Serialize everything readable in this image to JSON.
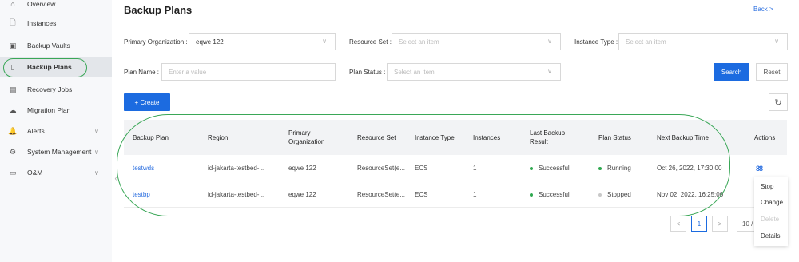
{
  "sidebar": {
    "items": [
      {
        "label": "Overview",
        "icon": "home-icon",
        "glyph": "⌂"
      },
      {
        "label": "Instances",
        "icon": "file-icon",
        "glyph": "🗋"
      },
      {
        "label": "Backup Vaults",
        "icon": "vault-icon",
        "glyph": "▣"
      },
      {
        "label": "Backup Plans",
        "icon": "plan-icon",
        "glyph": "▯"
      },
      {
        "label": "Recovery Jobs",
        "icon": "list-icon",
        "glyph": "▤"
      },
      {
        "label": "Migration Plan",
        "icon": "cloud-icon",
        "glyph": "☁"
      },
      {
        "label": "Alerts",
        "icon": "bell-icon",
        "glyph": "🔔"
      },
      {
        "label": "System Management",
        "icon": "gear-icon",
        "glyph": "⚙"
      },
      {
        "label": "O&M",
        "icon": "monitor-icon",
        "glyph": "▭"
      }
    ],
    "chevron": "∨",
    "collapse_glyph": "‹"
  },
  "header": {
    "title": "Backup Plans",
    "back_label": "Back  >"
  },
  "filters": {
    "primary_org_label": "Primary Organization :",
    "primary_org_value": "eqwe 122",
    "resource_set_label": "Resource Set :",
    "resource_set_placeholder": "Select an item",
    "instance_type_label": "Instance Type :",
    "instance_type_placeholder": "Select an item",
    "plan_name_label": "Plan Name :",
    "plan_name_placeholder": "Enter a value",
    "plan_status_label": "Plan Status :",
    "plan_status_placeholder": "Select an item",
    "dropdown_glyph": "∨"
  },
  "buttons": {
    "search": "Search",
    "reset": "Reset",
    "create": "+  Create",
    "refresh_glyph": "↻"
  },
  "table": {
    "columns": [
      "Backup Plan",
      "Region",
      "Primary Organization",
      "Resource Set",
      "Instance Type",
      "Instances",
      "Last Backup Result",
      "Plan Status",
      "Next Backup Time",
      "Actions"
    ],
    "rows": [
      {
        "plan": "testwds",
        "region": "id-jakarta-testbed-...",
        "org": "eqwe 122",
        "resource_set": "ResourceSet(e...",
        "instance_type": "ECS",
        "instances": "1",
        "last_result": "Successful",
        "status": "Running",
        "next_time": "Oct 26, 2022, 17:30:00",
        "action_glyph": "88"
      },
      {
        "plan": "testbp",
        "region": "id-jakarta-testbed-...",
        "org": "eqwe 122",
        "resource_set": "ResourceSet(e...",
        "instance_type": "ECS",
        "instances": "1",
        "last_result": "Successful",
        "status": "Stopped",
        "next_time": "Nov 02, 2022, 16:25:00"
      }
    ]
  },
  "pagination": {
    "prev": "<",
    "current": "1",
    "next": ">",
    "page_size": "10 /"
  },
  "action_menu": {
    "items": [
      "Stop",
      "Change",
      "Delete",
      "Details"
    ]
  },
  "colors": {
    "primary": "#1c6be0",
    "link": "#2b6fe0",
    "success": "#2fa84f",
    "annotation": "#3aa757"
  }
}
